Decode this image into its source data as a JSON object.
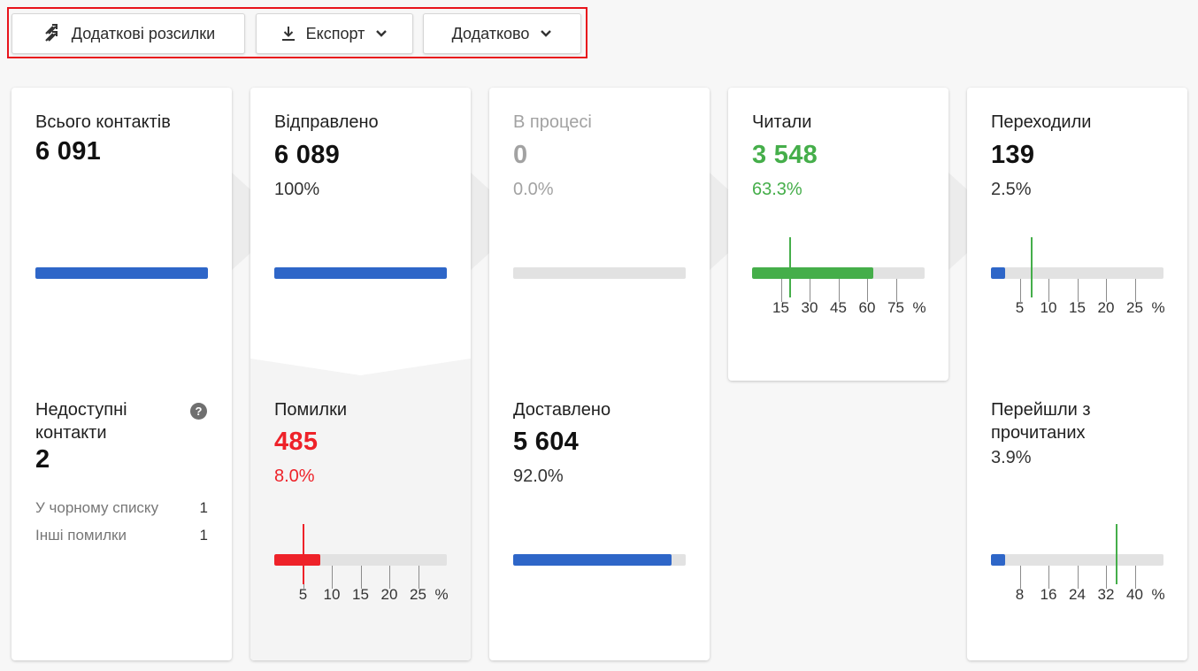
{
  "toolbar": {
    "extra_mailings": "Додаткові розсилки",
    "export": "Експорт",
    "additional": "Додатково"
  },
  "colors": {
    "accent": "#2e66c8",
    "success": "#45ae4a",
    "error": "#ee2229",
    "highlight_frame": "#e8141c"
  },
  "cards": {
    "total": {
      "label": "Всього контактів",
      "value": "6 091",
      "bar_fill": 1.0
    },
    "unavailable": {
      "label": "Недоступні контакти",
      "value": "2",
      "rows": [
        {
          "label": "У чорному списку",
          "value": "1"
        },
        {
          "label": "Інші помилки",
          "value": "1"
        }
      ]
    },
    "sent": {
      "label": "Відправлено",
      "value": "6 089",
      "percent": "100%",
      "bar_fill": 1.0
    },
    "errors": {
      "label": "Помилки",
      "value": "485",
      "percent": "8.0%",
      "scale": {
        "ticks": [
          "5",
          "10",
          "15",
          "20",
          "25"
        ],
        "unit": "%",
        "max": 30,
        "value": 8.0,
        "marker": 5
      }
    },
    "in_process": {
      "label": "В процесі",
      "value": "0",
      "percent": "0.0%",
      "bar_fill": 0.0
    },
    "delivered": {
      "label": "Доставлено",
      "value": "5 604",
      "percent": "92.0%",
      "bar_fill": 0.92
    },
    "read": {
      "label": "Читали",
      "value": "3 548",
      "percent": "63.3%",
      "scale": {
        "ticks": [
          "15",
          "30",
          "45",
          "60",
          "75"
        ],
        "unit": "%",
        "max": 90,
        "value": 63.3,
        "marker": 20
      }
    },
    "clicked": {
      "label": "Переходили",
      "value": "139",
      "percent": "2.5%",
      "scale": {
        "ticks": [
          "5",
          "10",
          "15",
          "20",
          "25"
        ],
        "unit": "%",
        "max": 30,
        "value": 2.5,
        "marker": 7
      }
    },
    "clicked_from_read": {
      "label": "Перейшли з прочитаних",
      "percent": "3.9%",
      "scale": {
        "ticks": [
          "8",
          "16",
          "24",
          "32",
          "40"
        ],
        "unit": "%",
        "max": 48,
        "value": 3.9,
        "marker": 35
      }
    }
  }
}
